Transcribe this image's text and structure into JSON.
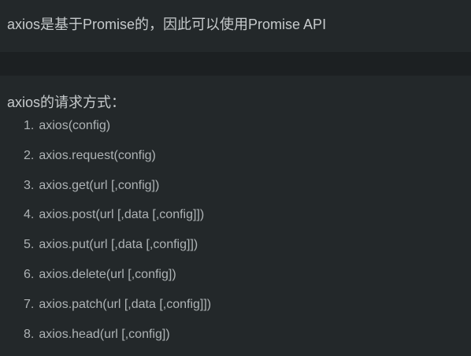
{
  "intro_text": "axios是基于Promise的，因此可以使用Promise API",
  "heading_text": "axios的请求方式：",
  "methods": [
    {
      "num": "1.",
      "text": "axios(config)"
    },
    {
      "num": "2.",
      "text": "axios.request(config)"
    },
    {
      "num": "3.",
      "text": "axios.get(url [,config])"
    },
    {
      "num": "4.",
      "text": "axios.post(url [,data [,config]])"
    },
    {
      "num": "5.",
      "text": "axios.put(url [,data [,config]])"
    },
    {
      "num": "6.",
      "text": "axios.delete(url [,config])"
    },
    {
      "num": "7.",
      "text": "axios.patch(url [,data [,config]])"
    },
    {
      "num": "8.",
      "text": "axios.head(url [,config])"
    }
  ]
}
